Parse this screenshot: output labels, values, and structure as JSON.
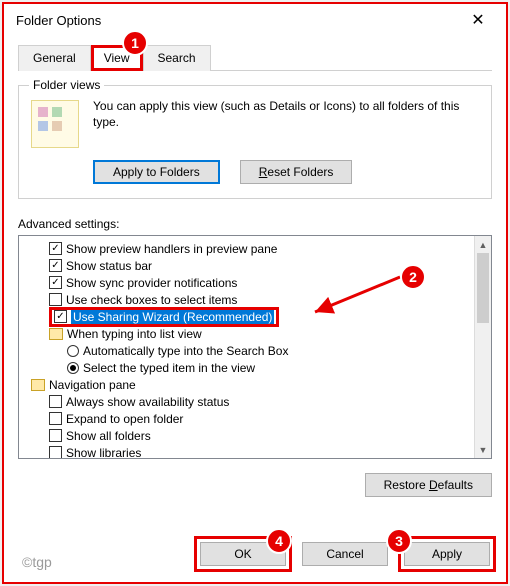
{
  "window": {
    "title": "Folder Options",
    "close_glyph": "✕"
  },
  "tabs": {
    "general": "General",
    "view": "View",
    "search": "Search"
  },
  "folder_views": {
    "legend": "Folder views",
    "text": "You can apply this view (such as Details or Icons) to all folders of this type.",
    "apply": "Apply to Folders",
    "reset": "Reset Folders"
  },
  "advanced": {
    "label": "Advanced settings:",
    "items": {
      "preview": "Show preview handlers in preview pane",
      "statusbar": "Show status bar",
      "sync": "Show sync provider notifications",
      "checkboxes": "Use check boxes to select items",
      "sharing": "Use Sharing Wizard (Recommended)",
      "typing_header": "When typing into list view",
      "typing_auto": "Automatically type into the Search Box",
      "typing_select": "Select the typed item in the view",
      "nav_header": "Navigation pane",
      "nav_avail": "Always show availability status",
      "nav_expand": "Expand to open folder",
      "nav_showall": "Show all folders",
      "nav_libs": "Show libraries"
    }
  },
  "buttons": {
    "restore": "Restore Defaults",
    "ok": "OK",
    "cancel": "Cancel",
    "apply": "Apply"
  },
  "watermark": "©tgp",
  "markers": {
    "m1": "1",
    "m2": "2",
    "m3": "3",
    "m4": "4"
  },
  "underline": {
    "reset": "R",
    "defaults": "D"
  }
}
